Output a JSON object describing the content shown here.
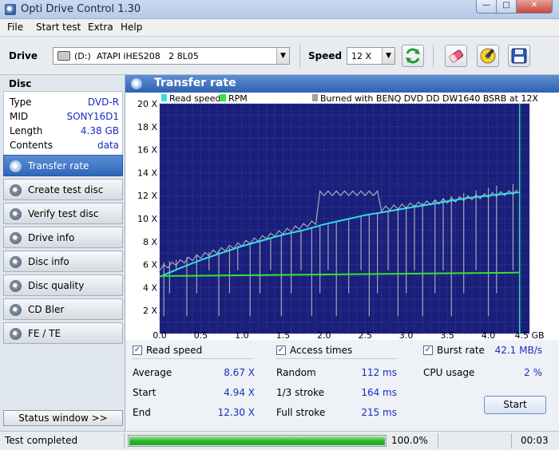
{
  "window": {
    "title": "Opti Drive Control 1.30",
    "min": "—",
    "max": "□",
    "close": "✕"
  },
  "menu": [
    "File",
    "Start test",
    "Extra",
    "Help"
  ],
  "toolbar": {
    "drive_label": "Drive",
    "drive_letter": "(D:)",
    "drive_model": "ATAPI iHES208   2 8L05",
    "speed_label": "Speed",
    "speed_value": "12 X"
  },
  "disc": {
    "header": "Disc",
    "rows": [
      {
        "key": "Type",
        "value": "DVD-R"
      },
      {
        "key": "MID",
        "value": "SONY16D1"
      },
      {
        "key": "Length",
        "value": "4.38 GB"
      },
      {
        "key": "Contents",
        "value": "data"
      }
    ]
  },
  "nav": [
    {
      "label": "Transfer rate",
      "active": true
    },
    {
      "label": "Create test disc",
      "active": false
    },
    {
      "label": "Verify test disc",
      "active": false
    },
    {
      "label": "Drive info",
      "active": false
    },
    {
      "label": "Disc info",
      "active": false
    },
    {
      "label": "Disc quality",
      "active": false
    },
    {
      "label": "CD Bler",
      "active": false
    },
    {
      "label": "FE / TE",
      "active": false
    }
  ],
  "status_window_label": "Status window >>",
  "main": {
    "title": "Transfer rate",
    "checks": {
      "read_speed": "Read speed",
      "access_times": "Access times",
      "burst_rate": "Burst rate",
      "burst_value": "42.1 MB/s"
    },
    "speed_stats": [
      {
        "key": "Average",
        "value": "8.67 X"
      },
      {
        "key": "Start",
        "value": "4.94 X"
      },
      {
        "key": "End",
        "value": "12.30 X"
      }
    ],
    "access_stats": [
      {
        "key": "Random",
        "value": "112 ms"
      },
      {
        "key": "1/3 stroke",
        "value": "164 ms"
      },
      {
        "key": "Full stroke",
        "value": "215 ms"
      }
    ],
    "cpu_label": "CPU usage",
    "cpu_value": "2 %",
    "start_label": "Start"
  },
  "status": {
    "text": "Test completed",
    "progress": 1.0,
    "progress_text": "100.0%",
    "time": "00:03"
  },
  "chart_data": {
    "type": "line",
    "legend": {
      "read_speed": "Read speed",
      "rpm": "RPM",
      "burned": "Burned with BENQ DVD DD DW1640 BSRB at 12X"
    },
    "xlim": [
      0,
      4.5
    ],
    "ylim": [
      0,
      20
    ],
    "x_ticks": [
      "0.0",
      "0.5",
      "1.0",
      "1.5",
      "2.0",
      "2.5",
      "3.0",
      "3.5",
      "4.0",
      "4.5 GB"
    ],
    "y_ticks": [
      "2 X",
      "4 X",
      "6 X",
      "8 X",
      "10 X",
      "12 X",
      "14 X",
      "16 X",
      "18 X",
      "20 X"
    ],
    "series": [
      {
        "name": "Read speed",
        "color": "#33e0e0",
        "x": [
          0.0,
          0.25,
          0.5,
          0.75,
          1.0,
          1.25,
          1.5,
          1.75,
          2.0,
          2.25,
          2.5,
          2.75,
          3.0,
          3.25,
          3.5,
          3.75,
          4.0,
          4.25,
          4.38
        ],
        "y": [
          4.94,
          5.7,
          6.4,
          7.0,
          7.6,
          8.1,
          8.6,
          9.0,
          9.5,
          9.9,
          10.3,
          10.6,
          10.9,
          11.2,
          11.5,
          11.8,
          12.0,
          12.2,
          12.3
        ]
      },
      {
        "name": "RPM",
        "color": "#2ee82e",
        "x": [
          0.0,
          4.38
        ],
        "y": [
          5.0,
          5.3
        ]
      }
    ],
    "end_marker_x": 4.38,
    "grid": true,
    "background": "#1a1f7a"
  }
}
